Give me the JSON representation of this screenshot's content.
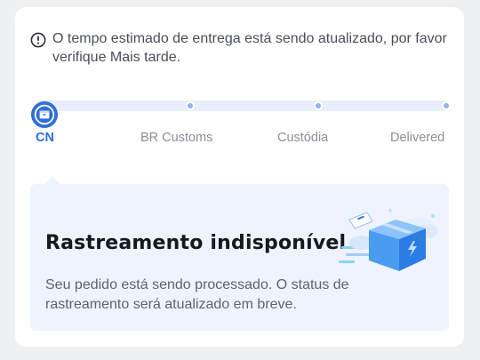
{
  "notice": {
    "icon": "info-circle-icon",
    "text": "O tempo estimado de entrega está sendo atualizado, por favor verifique Mais tarde."
  },
  "tracking": {
    "start_icon": "package-box-icon",
    "active_color": "#2f6fd6",
    "steps": [
      {
        "label": "CN",
        "active": true
      },
      {
        "label": "BR Customs",
        "active": false
      },
      {
        "label": "Custódia",
        "active": false
      },
      {
        "label": "Delivered",
        "active": false
      }
    ]
  },
  "status_panel": {
    "title": "Rastreamento indisponível",
    "description": "Seu pedido está sendo processado. O status de rastreamento será atualizado em breve.",
    "illustration": "delivery-box-illustration"
  }
}
